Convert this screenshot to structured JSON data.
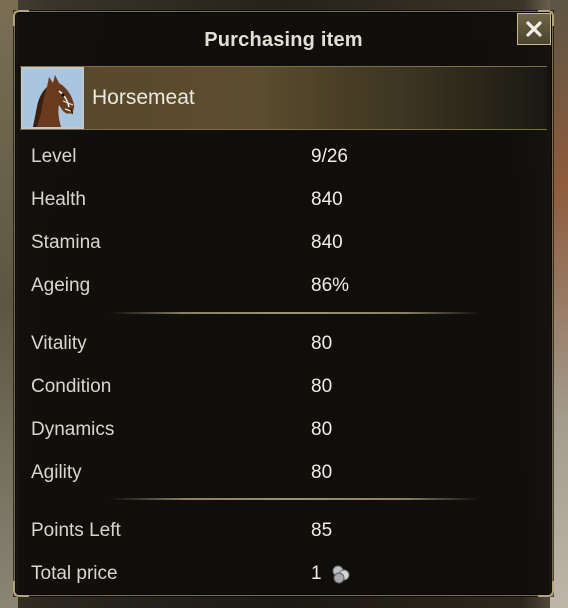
{
  "dialog": {
    "title": "Purchasing item",
    "close_icon": "close-x-icon"
  },
  "item": {
    "name": "Horsemeat",
    "icon": "horse-portrait-icon"
  },
  "stats_group1": [
    {
      "label": "Level",
      "value": "9/26"
    },
    {
      "label": "Health",
      "value": "840"
    },
    {
      "label": "Stamina",
      "value": "840"
    },
    {
      "label": "Ageing",
      "value": "86%"
    }
  ],
  "stats_group2": [
    {
      "label": "Vitality",
      "value": "80"
    },
    {
      "label": "Condition",
      "value": "80"
    },
    {
      "label": "Dynamics",
      "value": "80"
    },
    {
      "label": "Agility",
      "value": "80"
    }
  ],
  "summary": {
    "points_left_label": "Points Left",
    "points_left_value": "85",
    "total_price_label": "Total price",
    "total_price_value": "1",
    "currency_icon": "silver-coins-icon"
  },
  "colors": {
    "frame_gold": "#b7a476",
    "item_bar": "#5b4d2e",
    "text": "#d9d6cd"
  }
}
